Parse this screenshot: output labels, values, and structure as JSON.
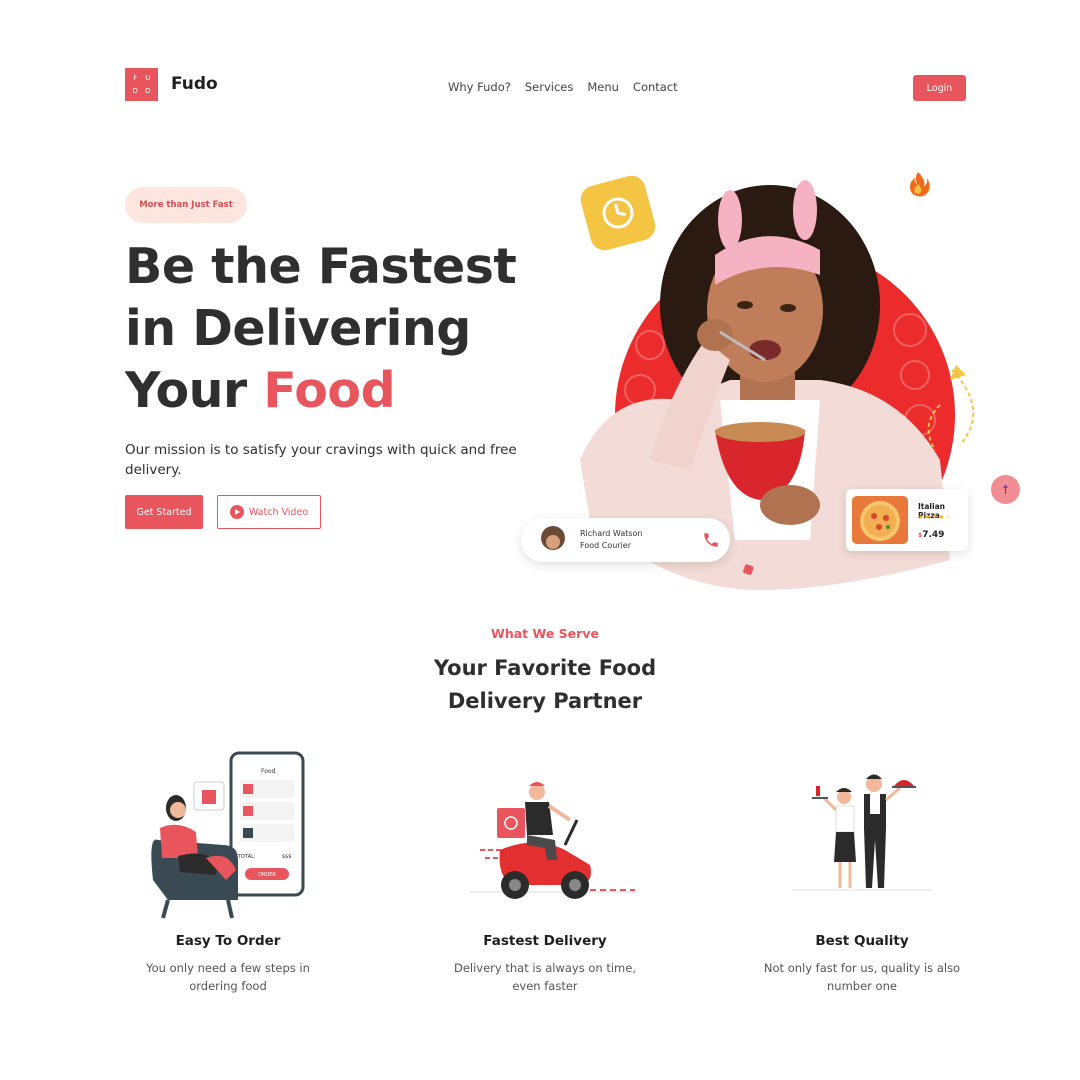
{
  "nav": {
    "logo_letters": [
      "F",
      "U",
      "D",
      "O"
    ],
    "brand": "Fudo",
    "links": [
      "Why Fudo?",
      "Services",
      "Menu",
      "Contact"
    ],
    "login": "Login"
  },
  "hero": {
    "pill": "More than Just Fast",
    "headline_line1": "Be the Fastest",
    "headline_line2": "in Delivering",
    "headline_line3_prefix": "Your ",
    "headline_line3_accent": "Food",
    "mission": "Our mission is to satisfy your cravings with quick and free delivery.",
    "cta_primary": "Get Started",
    "cta_secondary": "Watch Video",
    "courier": {
      "name": "Richard Watson",
      "role": "Food Courier"
    },
    "product": {
      "name": "Italian Pizza",
      "currency": "$",
      "price": "7.49",
      "stars": "★★★★☆"
    }
  },
  "services": {
    "eyebrow": "What We Serve",
    "title_line1": "Your Favorite Food",
    "title_line2": "Delivery Partner",
    "features": [
      {
        "title": "Easy To Order",
        "desc_line1": "You only need a few steps in",
        "desc_line2": "ordering food"
      },
      {
        "title": "Fastest Delivery",
        "desc_line1": "Delivery that is always on time,",
        "desc_line2": "even faster"
      },
      {
        "title": "Best Quality",
        "desc_line1": "Not only fast for us, quality is also",
        "desc_line2": "number one"
      }
    ]
  },
  "mockup": {
    "app_title": "Food",
    "total_label": "TOTAL:",
    "total_value": "$$$",
    "order_button": "ORDER"
  },
  "colors": {
    "accent": "#e8555c",
    "accent_light": "#fde6df",
    "yellow": "#f4c542",
    "text": "#2f2f2f"
  },
  "icons": [
    "clock-icon",
    "fire-icon",
    "phone-icon",
    "play-icon",
    "arrow-up-icon",
    "star-icon"
  ]
}
